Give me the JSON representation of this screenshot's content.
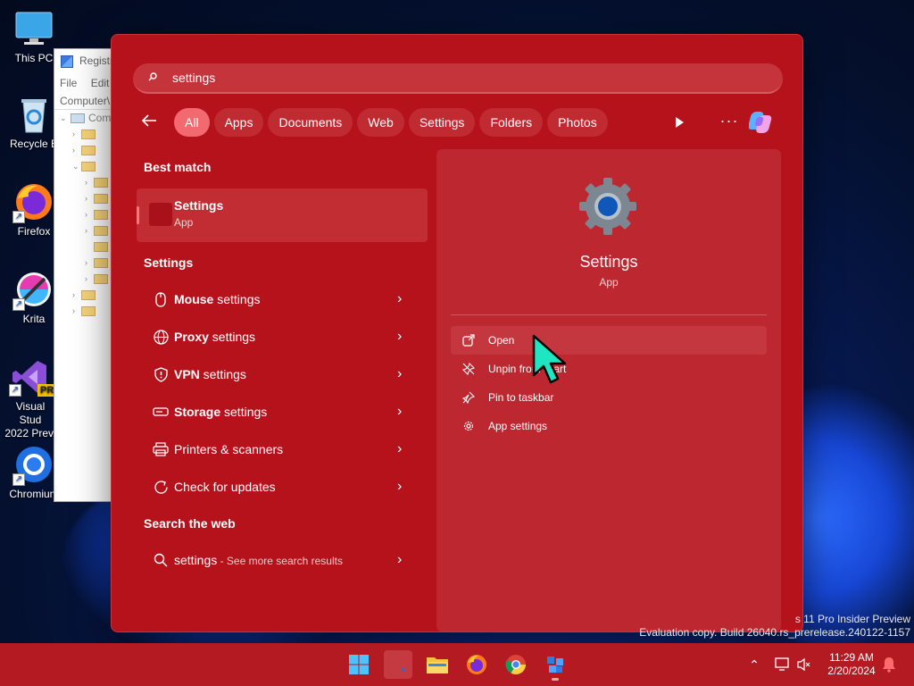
{
  "desktop": {
    "icons": [
      {
        "label": "This PC"
      },
      {
        "label": "Recycle B"
      },
      {
        "label": "Firefox"
      },
      {
        "label": "Krita"
      },
      {
        "label": "Visual Stud\n2022 Previ",
        "badge": "PRE"
      },
      {
        "label": "Chromium"
      }
    ]
  },
  "regedit": {
    "title": "Registr",
    "menu": [
      "File",
      "Edit"
    ],
    "address": "Computer\\",
    "root": "Com"
  },
  "search": {
    "query": "settings",
    "filters": [
      "All",
      "Apps",
      "Documents",
      "Web",
      "Settings",
      "Folders",
      "Photos"
    ],
    "active_filter": "All",
    "more_label": "···"
  },
  "best_match": {
    "section": "Best match",
    "name": "Settings",
    "type": "App"
  },
  "settings_section": {
    "title": "Settings",
    "items": [
      {
        "bold": "Mouse",
        "rest": " settings",
        "icon": "mouse-icon"
      },
      {
        "bold": "Proxy",
        "rest": " settings",
        "icon": "globe-icon"
      },
      {
        "bold": "VPN",
        "rest": " settings",
        "icon": "shield-icon"
      },
      {
        "bold": "Storage",
        "rest": " settings",
        "icon": "storage-icon"
      },
      {
        "bold": "",
        "rest": "Printers & scanners",
        "icon": "printer-icon"
      },
      {
        "bold": "",
        "rest": "Check for updates",
        "icon": "sync-icon"
      }
    ]
  },
  "web_section": {
    "title": "Search the web",
    "query": "settings",
    "hint": " - See more search results"
  },
  "detail": {
    "name": "Settings",
    "type": "App",
    "actions": [
      "Open",
      "Unpin from Start",
      "Pin to taskbar",
      "App settings"
    ]
  },
  "watermark": {
    "line1": "s 11 Pro Insider Preview",
    "line2": "Evaluation copy. Build 26040.rs_prerelease.240122-1157"
  },
  "taskbar": {
    "time": "11:29 AM",
    "date": "2/20/2024"
  },
  "colors": {
    "accent": "#b5121b",
    "active_pill": "#f26a6f",
    "cursor": "#1de6c0"
  }
}
